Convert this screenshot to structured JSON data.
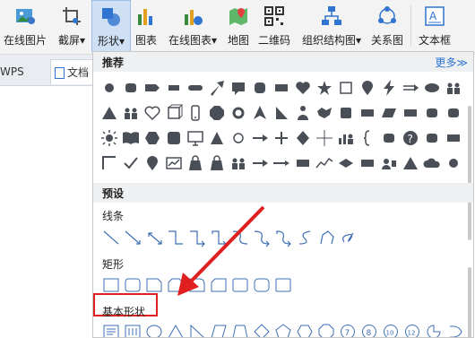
{
  "ribbon": {
    "buttons": [
      {
        "label": "在线图片",
        "icon": "online-picture-icon"
      },
      {
        "label": "截屏",
        "icon": "screenshot-icon"
      },
      {
        "label": "形状",
        "icon": "shapes-icon"
      },
      {
        "label": "图表",
        "icon": "chart-icon"
      },
      {
        "label": "在线图表",
        "icon": "online-chart-icon"
      },
      {
        "label": "地图",
        "icon": "map-icon"
      },
      {
        "label": "二维码",
        "icon": "qrcode-icon"
      },
      {
        "label": "组织结构图",
        "icon": "org-chart-icon"
      },
      {
        "label": "关系图",
        "icon": "relation-chart-icon"
      },
      {
        "label": "文本框",
        "icon": "textbox-icon"
      }
    ]
  },
  "tabs": {
    "wps": "WPS",
    "doc": "文档"
  },
  "panel": {
    "recommend": "推荐",
    "more": "更多≫",
    "preset": "预设",
    "lines": "线条",
    "rect": "矩形",
    "basic": "基本形状"
  },
  "colors": {
    "icon_fill": "#4a4f57",
    "accent_blue": "#2f74d0",
    "arrow_red": "#e02020",
    "line_blue": "#3d6fb6"
  }
}
